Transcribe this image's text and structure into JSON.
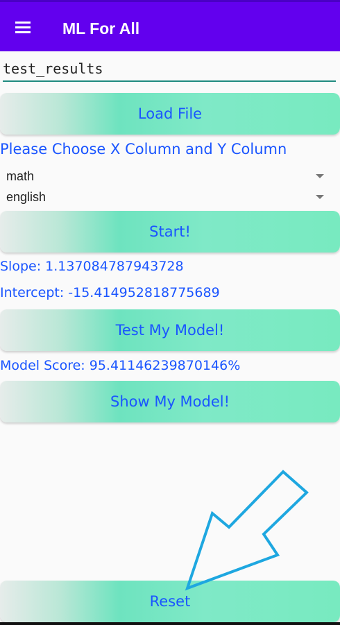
{
  "appbar": {
    "title": "ML For All",
    "menu_icon": "hamburger-menu-icon",
    "color": "#6200ee"
  },
  "file": {
    "filename_value": "test_results",
    "load_button": "Load File"
  },
  "columns": {
    "prompt": "Please Choose X Column and Y Column",
    "x_column": "math",
    "y_column": "english"
  },
  "train": {
    "start_button": "Start!",
    "slope_text": "Slope: 1.137084787943728",
    "intercept_text": "Intercept: -15.414952818775689"
  },
  "test": {
    "test_button": "Test My Model!",
    "score_text": "Model Score: 95.41146239870146%"
  },
  "show": {
    "show_button": "Show My Model!"
  },
  "reset": {
    "reset_button": "Reset"
  },
  "colors": {
    "text_accent": "#1a55ff",
    "annotation_arrow": "#1ea7e0"
  }
}
